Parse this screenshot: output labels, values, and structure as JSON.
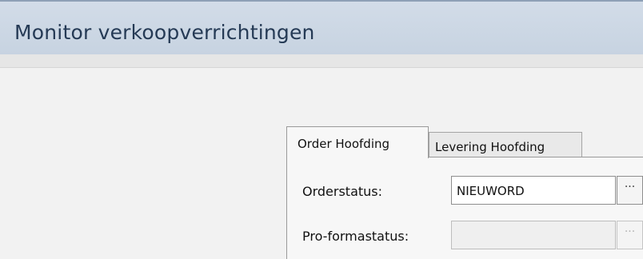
{
  "window": {
    "title": "Monitor verkoopverrichtingen"
  },
  "tabs": [
    {
      "label": "Order Hoofding",
      "active": true
    },
    {
      "label": "Levering Hoofding",
      "active": false
    }
  ],
  "form": {
    "orderstatus": {
      "label": "Orderstatus:",
      "value": "NIEUWORD",
      "browse_label": "···"
    },
    "proforma": {
      "label": "Pro-formastatus:",
      "value": "",
      "browse_label": "···"
    }
  },
  "colors": {
    "titlebar": "#c9d5e3",
    "title_text": "#253a55"
  }
}
